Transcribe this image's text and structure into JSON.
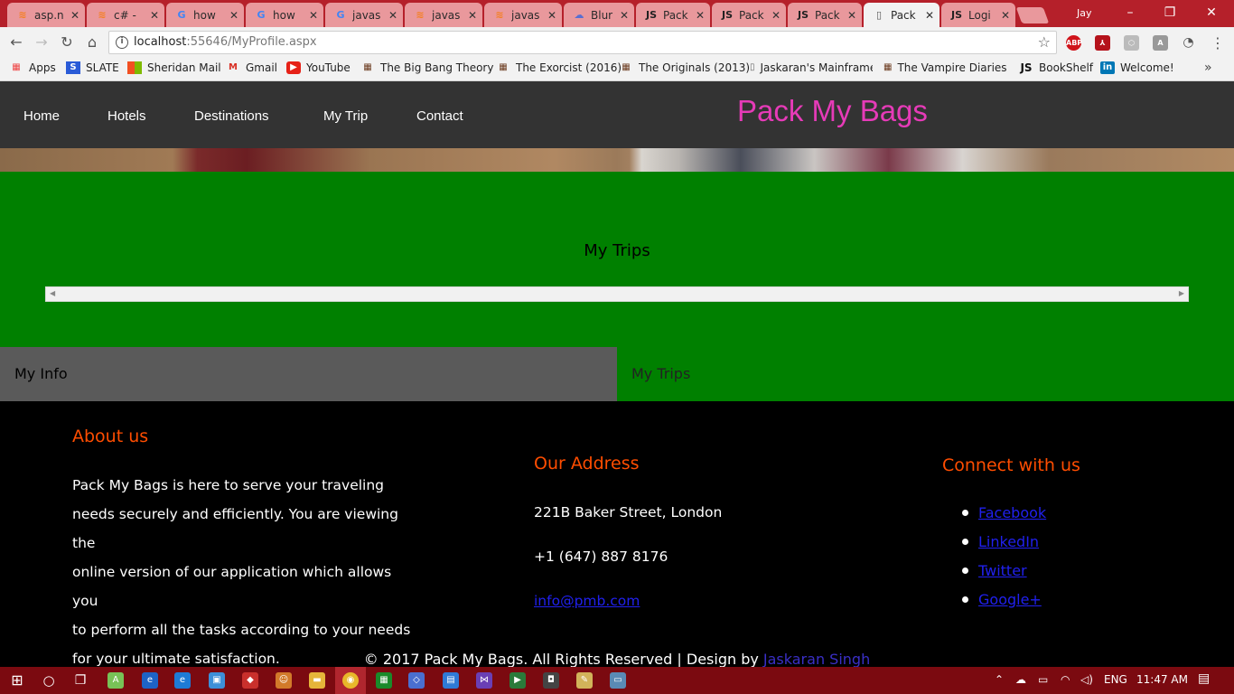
{
  "browser": {
    "tabs": [
      {
        "label": "asp.n",
        "icon": "stackoverflow-icon",
        "active": false
      },
      {
        "label": "c# -",
        "icon": "stackoverflow-icon",
        "active": false
      },
      {
        "label": "how",
        "icon": "google-icon",
        "active": false
      },
      {
        "label": "how",
        "icon": "google-icon",
        "active": false
      },
      {
        "label": "javas",
        "icon": "google-icon",
        "active": false
      },
      {
        "label": "javas",
        "icon": "stackoverflow-icon",
        "active": false
      },
      {
        "label": "javas",
        "icon": "stackoverflow-icon",
        "active": false
      },
      {
        "label": "Blur",
        "icon": "cloud-icon",
        "active": false
      },
      {
        "label": "Pack",
        "icon": "js-icon",
        "active": false
      },
      {
        "label": "Pack",
        "icon": "js-icon",
        "active": false
      },
      {
        "label": "Pack",
        "icon": "js-icon",
        "active": false
      },
      {
        "label": "Pack",
        "icon": "page-icon",
        "active": true
      },
      {
        "label": "Logi",
        "icon": "js-icon",
        "active": false
      }
    ],
    "user": "Jay",
    "url_host": "localhost",
    "url_rest": ":55646/MyProfile.aspx",
    "bookmarks": [
      {
        "label": "Apps",
        "icon": "apps-grid-icon"
      },
      {
        "label": "SLATE",
        "icon": "slate-icon"
      },
      {
        "label": "Sheridan Mail",
        "icon": "microsoft-icon"
      },
      {
        "label": "Gmail",
        "icon": "gmail-icon"
      },
      {
        "label": "YouTube",
        "icon": "youtube-icon"
      },
      {
        "label": "The Big Bang Theory",
        "icon": "film-icon"
      },
      {
        "label": "The Exorcist (2016)",
        "icon": "film-icon"
      },
      {
        "label": "The Originals (2013)",
        "icon": "film-icon"
      },
      {
        "label": "Jaskaran's Mainframe",
        "icon": "page-icon"
      },
      {
        "label": "The Vampire Diaries (",
        "icon": "film-icon"
      },
      {
        "label": "BookShelf",
        "icon": "js-icon"
      },
      {
        "label": "Welcome!",
        "icon": "linkedin-icon"
      }
    ]
  },
  "site": {
    "nav": [
      "Home",
      "Hotels",
      "Destinations",
      "My Trip",
      "Contact"
    ],
    "brand": "Pack My Bags",
    "brand_color": "#e63bb8",
    "header_bg": "#333333"
  },
  "trips_panel": {
    "title": "My Trips",
    "bg": "#008000"
  },
  "tabs": {
    "info": "My Info",
    "trips": "My Trips"
  },
  "footer": {
    "about_heading": "About us",
    "about_lines": [
      "Pack My Bags is here to serve your traveling",
      "needs securely and efficiently. You are viewing the",
      "online version of our application which allows you",
      "to perform all the tasks according to your needs",
      "for your ultimate satisfaction."
    ],
    "address_heading": "Our Address",
    "address": "221B Baker Street, London",
    "phone": "+1 (647) 887 8176",
    "email": "info@pmb.com",
    "connect_heading": "Connect with us",
    "social": [
      "Facebook",
      "LinkedIn",
      "Twitter",
      "Google+"
    ],
    "copyright": "© 2017 Pack My Bags. All Rights Reserved | Design by ",
    "author": "Jaskaran Singh",
    "heading_color": "#ff4d00"
  },
  "taskbar": {
    "language": "ENG",
    "time": "11:47 AM"
  }
}
